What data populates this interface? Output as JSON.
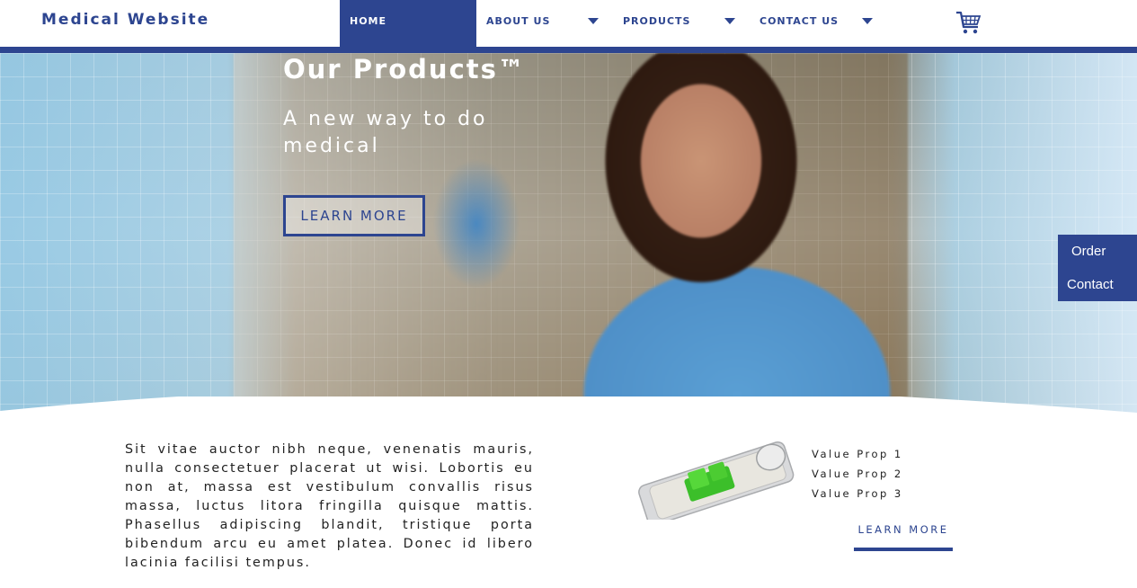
{
  "header": {
    "brand": "Medical Website",
    "nav": [
      {
        "label": "HOME"
      },
      {
        "label": "ABOUT US"
      },
      {
        "label": "PRODUCTS"
      },
      {
        "label": "CONTACT US"
      }
    ],
    "cart_icon": "shopping-cart-icon"
  },
  "hero": {
    "title": "Our Products™",
    "subtitle": "A new way to do medical",
    "button_label": "LEARN MORE"
  },
  "side_tab": {
    "order_label": "Order",
    "contact_label": "Contact"
  },
  "content": {
    "paragraph": "Sit vitae auctor nibh neque, venenatis mauris, nulla consectetuer placerat ut wisi. Lobortis eu non at, massa est vestibulum convallis risus massa, luctus litora fringilla quisque mattis. Phasellus adipiscing blandit, tristique porta bibendum arcu eu amet platea. Donec id libero lacinia facilisi tempus.",
    "value_props": [
      "Value Prop 1",
      "Value Prop 2",
      "Value Prop 3"
    ],
    "button_label": "LEARN MORE"
  },
  "colors": {
    "brand": "#2d4590",
    "white": "#ffffff"
  }
}
